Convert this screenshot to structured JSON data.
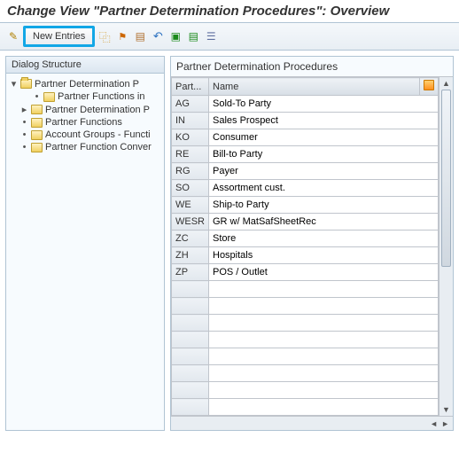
{
  "title": "Change View \"Partner Determination Procedures\": Overview",
  "toolbar": {
    "new_entries": "New Entries"
  },
  "dialog": {
    "header": "Dialog Structure",
    "nodes": {
      "n0": "Partner Determination P",
      "n1": "Partner Functions in",
      "n2": "Partner Determination P",
      "n3": "Partner Functions",
      "n4": "Account Groups - Functi",
      "n5": "Partner Function Conver"
    }
  },
  "table": {
    "title": "Partner Determination Procedures",
    "col_part": "Part...",
    "col_name": "Name",
    "rows": [
      {
        "code": "AG",
        "name": "Sold-To Party"
      },
      {
        "code": "IN",
        "name": "Sales Prospect"
      },
      {
        "code": "KO",
        "name": "Consumer"
      },
      {
        "code": "RE",
        "name": "Bill-to Party"
      },
      {
        "code": "RG",
        "name": "Payer"
      },
      {
        "code": "SO",
        "name": "Assortment cust."
      },
      {
        "code": "WE",
        "name": "Ship-to Party"
      },
      {
        "code": "WESR",
        "name": "GR w/ MatSafSheetRec"
      },
      {
        "code": "ZC",
        "name": "Store"
      },
      {
        "code": "ZH",
        "name": "Hospitals"
      },
      {
        "code": "ZP",
        "name": "POS / Outlet"
      }
    ]
  }
}
